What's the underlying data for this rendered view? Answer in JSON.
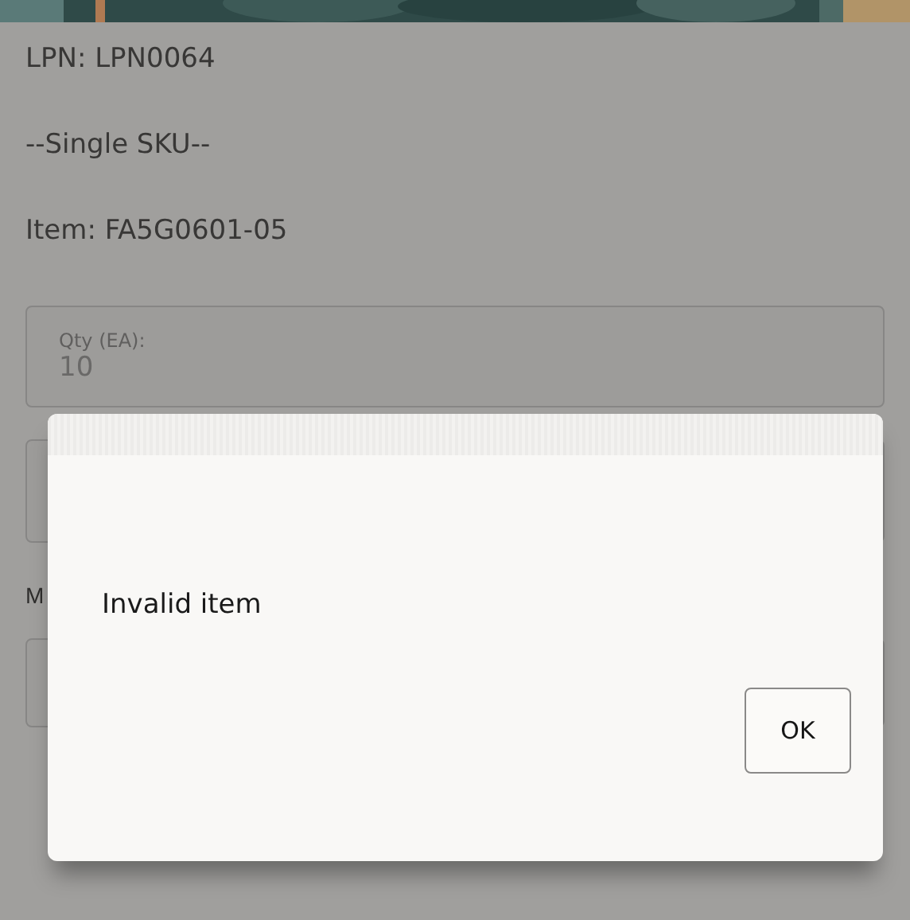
{
  "lines": [
    {
      "text": "LPN: LPN0064"
    },
    {
      "text": "--Single SKU--"
    },
    {
      "text": "Item: FA5G0601-05"
    }
  ],
  "qty_field": {
    "label": "Qty (EA):",
    "value": "10"
  },
  "partial_label": "M",
  "dialog": {
    "message": "Invalid item",
    "buttons": [
      "OK"
    ]
  }
}
